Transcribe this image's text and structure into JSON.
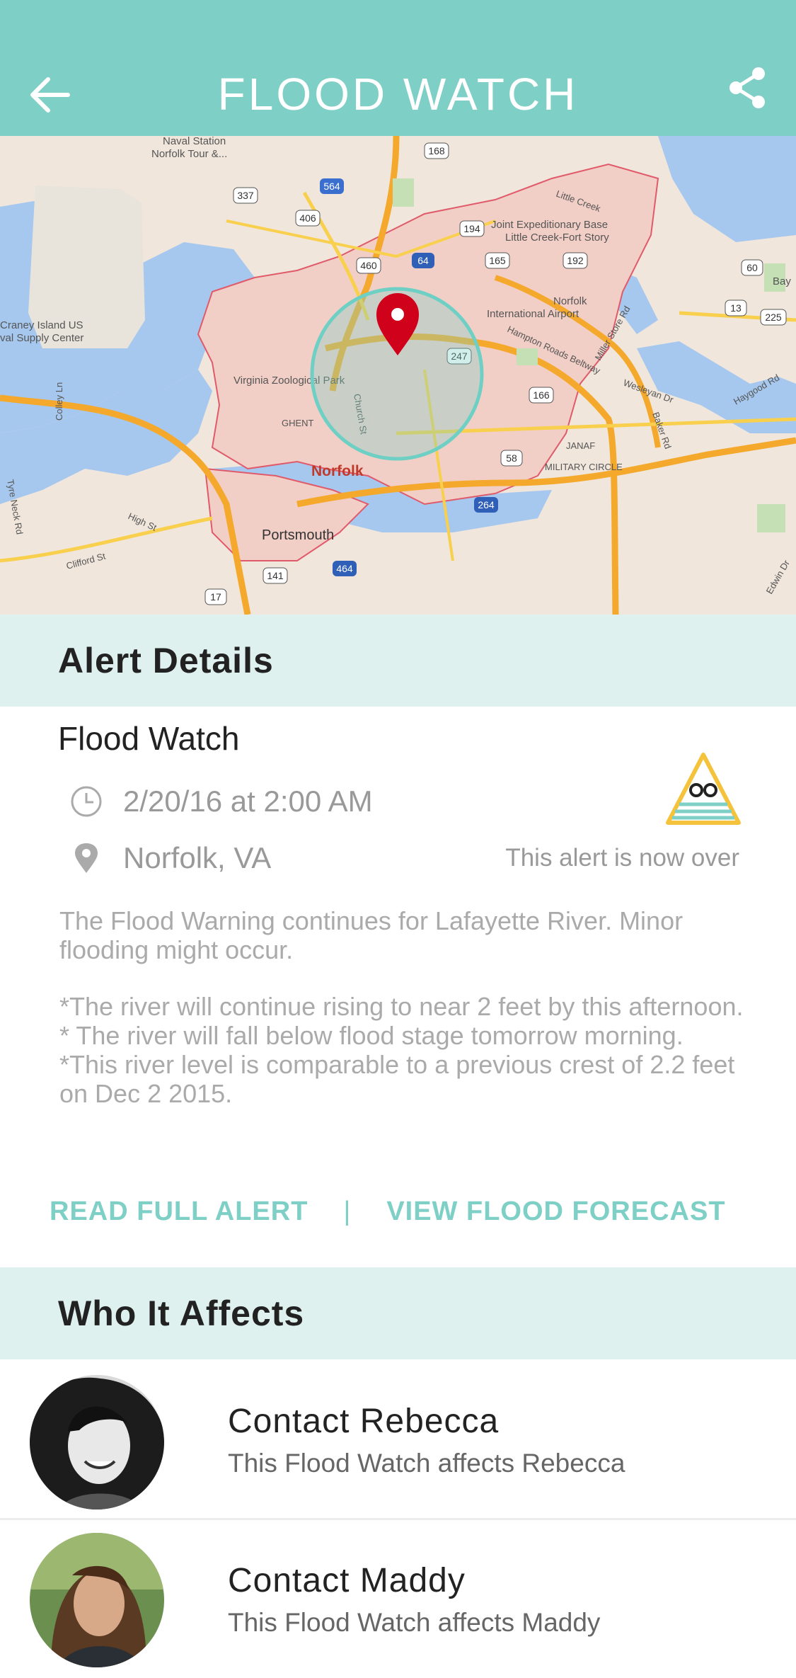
{
  "header": {
    "title": "FLOOD WATCH",
    "back_icon": "arrow-left-icon",
    "share_icon": "share-icon",
    "bg_color": "#7ecfc6"
  },
  "map": {
    "labels": {
      "naval_station": "Naval Station",
      "naval_tour": "Norfolk Tour &...",
      "craney_1": "Craney Island US",
      "craney_2": "val Supply Center",
      "jeb_1": "Joint Expeditionary Base",
      "jeb_2": "Little Creek-Fort Story",
      "airport_1": "Norfolk",
      "airport_2": "International Airport",
      "zoo": "Virginia Zoological Park",
      "norfolk": "Norfolk",
      "portsmouth": "Portsmouth",
      "ghent": "GHENT",
      "janaf": "JANAF",
      "military_circle": "MILITARY CIRCLE",
      "little_creek": "Little Creek",
      "hampton_roads": "Hampton Roads Beltway",
      "church_st": "Church St",
      "bay": "Bay",
      "high_st": "High St",
      "clifford_st": "Clifford St",
      "wesleyan": "Wesleyan Dr",
      "baker_rd": "Baker Rd",
      "haygood": "Haygood Rd",
      "edwin": "Edwin Dr",
      "colley": "Colley Ln",
      "tyre_neck": "Tyre Neck Rd",
      "miller_store": "Miller Store Rd"
    },
    "shields": [
      "168",
      "564",
      "337",
      "406",
      "194",
      "460",
      "64",
      "165",
      "192",
      "60",
      "13",
      "225",
      "247",
      "166",
      "58",
      "264",
      "141",
      "17",
      "464"
    ]
  },
  "alert_section": {
    "title": "Alert Details",
    "alert_name": "Flood Watch",
    "time": "2/20/16 at 2:00 AM",
    "location": "Norfolk, VA",
    "status": "This alert is now over",
    "clock_icon": "clock-icon",
    "pin_icon": "location-pin-icon",
    "badge_icon": "flood-warning-icon",
    "body": [
      "The Flood Warning continues for Lafayette River. Minor flooding might occur.",
      "*The river will continue rising to near 2 feet by this afternoon.",
      "* The river will fall below flood stage tomorrow morning.",
      "*This river level is comparable to a previous crest of 2.2 feet on Dec 2 2015."
    ],
    "read_full_alert": "READ FULL ALERT",
    "separator": "|",
    "view_forecast": "VIEW FLOOD FORECAST"
  },
  "affects_section": {
    "title": "Who It Affects",
    "contacts": [
      {
        "name": "Contact Rebecca",
        "subtitle": "This Flood Watch affects Rebecca"
      },
      {
        "name": "Contact Maddy",
        "subtitle": "This Flood Watch affects Maddy"
      }
    ]
  }
}
